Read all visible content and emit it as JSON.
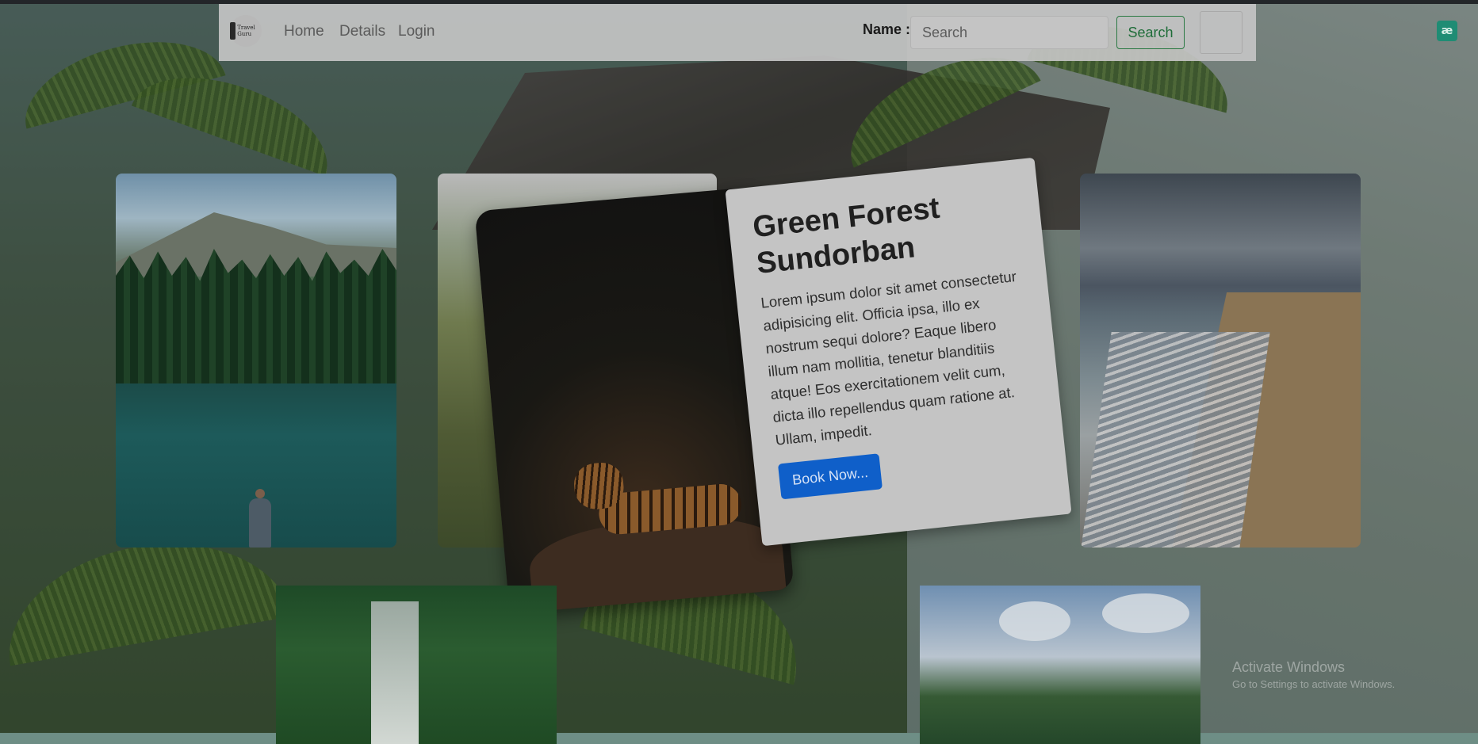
{
  "navbar": {
    "logo_text": "Travel Guru",
    "links": [
      "Home",
      "Details",
      "Login"
    ],
    "name_label": "Name :",
    "search_placeholder": "Search",
    "search_button": "Search"
  },
  "feature_card": {
    "title": "Green Forest Sundorban",
    "text": "Lorem ipsum dolor sit amet consectetur adipisicing elit. Officia ipsa, illo ex nostrum sequi dolore? Eaque libero illum nam mollitia, tenetur blanditiis atque! Eos exercitationem velit cum, dicta illo repellendus quam ratione at. Ullam, impedit.",
    "button": "Book Now..."
  },
  "extension_icon": "æ",
  "watermark": {
    "title": "Activate Windows",
    "subtitle": "Go to Settings to activate Windows."
  },
  "icons": {
    "logo": "suitcase-logo-icon",
    "extension": "extension-icon"
  }
}
